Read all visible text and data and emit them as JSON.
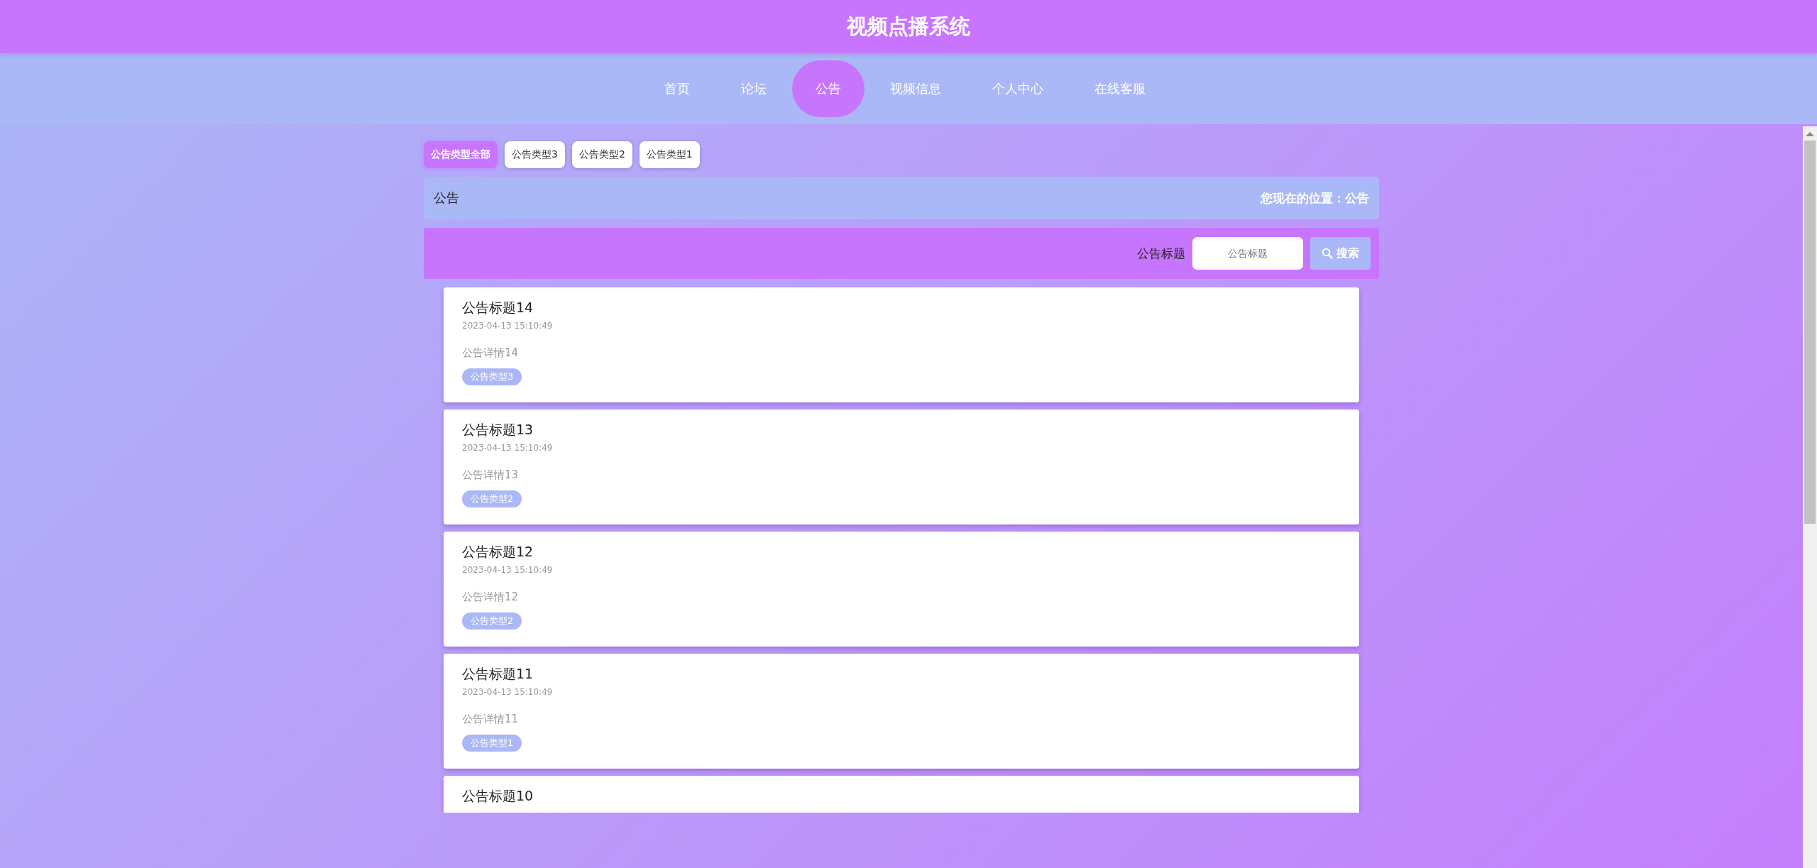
{
  "header": {
    "title": "视频点播系统"
  },
  "nav": [
    {
      "label": "首页",
      "selected": false
    },
    {
      "label": "论坛",
      "selected": false
    },
    {
      "label": "公告",
      "selected": true
    },
    {
      "label": "视频信息",
      "selected": false
    },
    {
      "label": "个人中心",
      "selected": false
    },
    {
      "label": "在线客服",
      "selected": false
    }
  ],
  "filters": [
    {
      "label": "公告类型全部",
      "selected": true
    },
    {
      "label": "公告类型3",
      "selected": false
    },
    {
      "label": "公告类型2",
      "selected": false
    },
    {
      "label": "公告类型1",
      "selected": false
    }
  ],
  "breadcrumb": {
    "title": "公告",
    "location": "您现在的位置：公告"
  },
  "search": {
    "label": "公告标题",
    "placeholder": "公告标题",
    "button": "搜索"
  },
  "notices": [
    {
      "title": "公告标题14",
      "date": "2023-04-13 15:10:49",
      "detail": "公告详情14",
      "tag": "公告类型3"
    },
    {
      "title": "公告标题13",
      "date": "2023-04-13 15:10:49",
      "detail": "公告详情13",
      "tag": "公告类型2"
    },
    {
      "title": "公告标题12",
      "date": "2023-04-13 15:10:49",
      "detail": "公告详情12",
      "tag": "公告类型2"
    },
    {
      "title": "公告标题11",
      "date": "2023-04-13 15:10:49",
      "detail": "公告详情11",
      "tag": "公告类型1"
    },
    {
      "title": "公告标题10"
    }
  ]
}
